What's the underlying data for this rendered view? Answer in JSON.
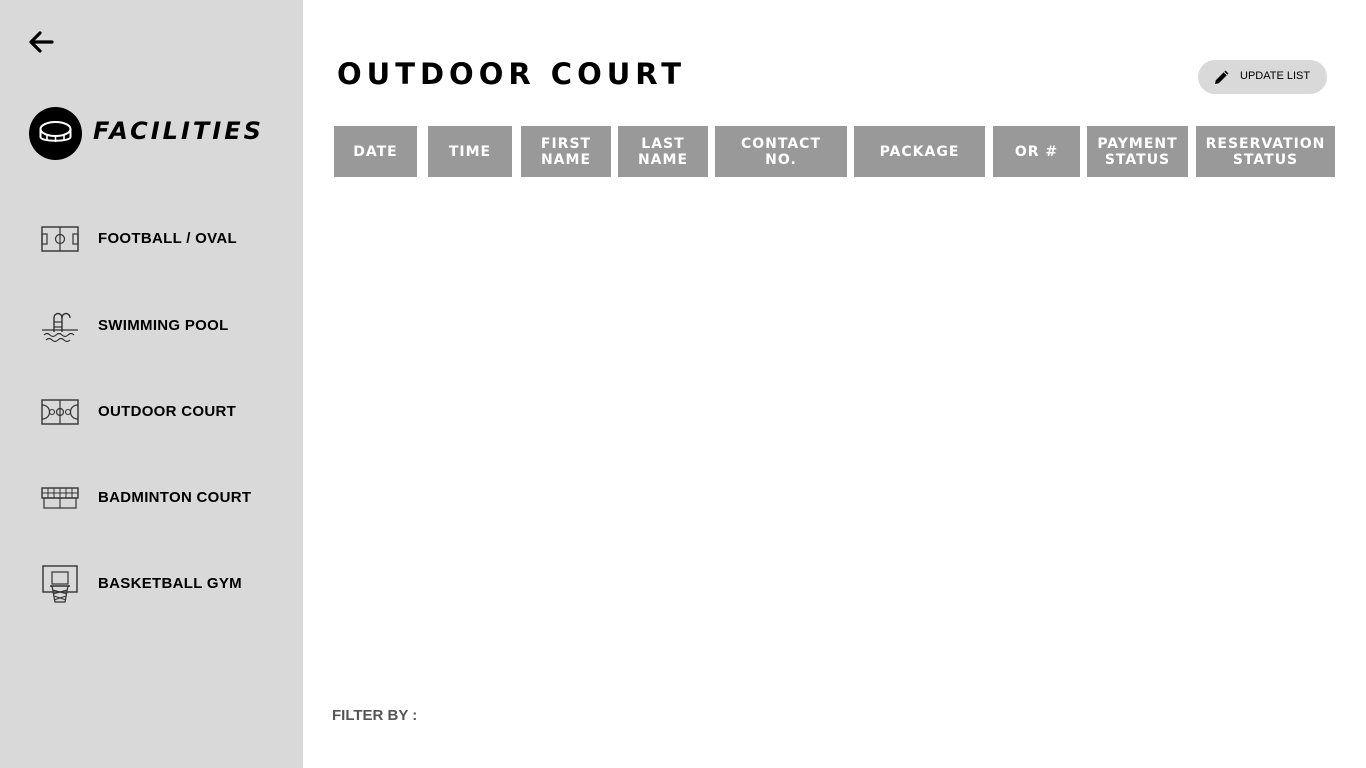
{
  "sidebar": {
    "brand_title": "FACILITIES",
    "items": [
      {
        "label": "FOOTBALL / OVAL",
        "icon": "football-field-icon"
      },
      {
        "label": "SWIMMING POOL",
        "icon": "swimming-pool-icon"
      },
      {
        "label": "OUTDOOR COURT",
        "icon": "outdoor-court-icon"
      },
      {
        "label": "BADMINTON COURT",
        "icon": "badminton-net-icon"
      },
      {
        "label": "BASKETBALL GYM",
        "icon": "basketball-hoop-icon"
      }
    ]
  },
  "main": {
    "title": "OUTDOOR COURT",
    "update_button_label": "UPDATE LIST",
    "table": {
      "columns": [
        "DATE",
        "TIME",
        "FIRST\nNAME",
        "LAST\nNAME",
        "CONTACT\nNO.",
        "PACKAGE",
        "OR #",
        "PAYMENT\nSTATUS",
        "RESERVATION\nSTATUS"
      ],
      "rows": []
    },
    "filter_label": "FILTER BY :"
  },
  "colors": {
    "sidebar_bg": "#d9d9d9",
    "header_cell_bg": "#999999",
    "header_text": "#ffffff"
  }
}
